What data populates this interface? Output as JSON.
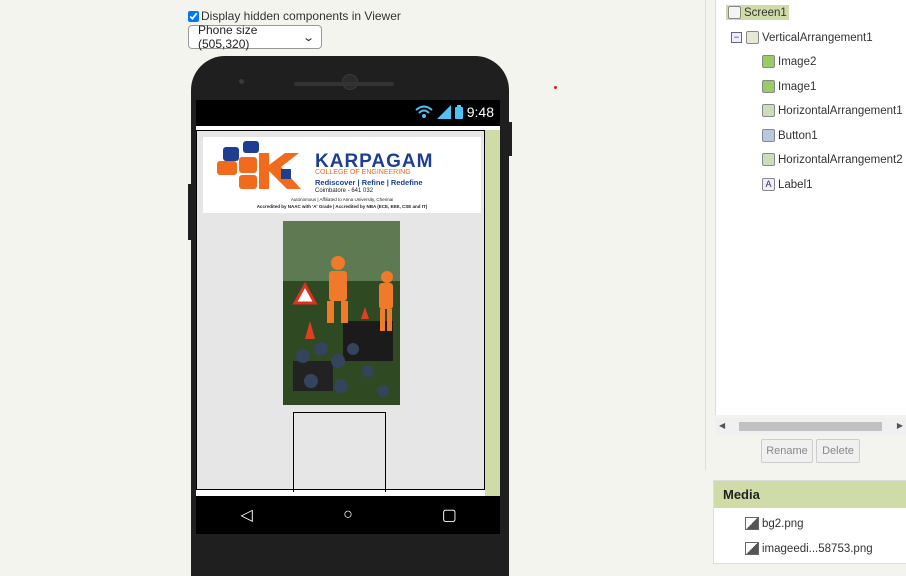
{
  "viewer": {
    "hidden_label": "Display hidden components in Viewer",
    "hidden_checked": true,
    "phone_size": "Phone size (505,320)"
  },
  "phone": {
    "status_time": "9:48",
    "logo": {
      "name": "KARPAGAM",
      "sub": "COLLEGE OF ENGINEERING",
      "tagline": "Rediscover | Refine | Redefine",
      "city": "Coimbatore - 641 032",
      "line1": "Autonomous | Affiliated to Anna University, Chennai",
      "line2": "Accredited by NAAC with 'A' Grade | Accredited by NBA (ECE, EEE, CSE and IT)"
    }
  },
  "tree": {
    "nodes": [
      {
        "label": "Screen1",
        "icon": "screen-icon"
      },
      {
        "label": "VerticalArrangement1",
        "icon": "vertical-arrangement-icon"
      },
      {
        "label": "Image2",
        "icon": "image-icon"
      },
      {
        "label": "Image1",
        "icon": "image-icon"
      },
      {
        "label": "HorizontalArrangement1",
        "icon": "horizontal-arrangement-icon"
      },
      {
        "label": "Button1",
        "icon": "button-icon"
      },
      {
        "label": "HorizontalArrangement2",
        "icon": "horizontal-arrangement-icon"
      },
      {
        "label": "Label1",
        "icon": "label-icon"
      }
    ],
    "rename": "Rename",
    "delete": "Delete"
  },
  "media": {
    "title": "Media",
    "items": [
      "bg2.png",
      "imageedi...58753.png"
    ]
  }
}
